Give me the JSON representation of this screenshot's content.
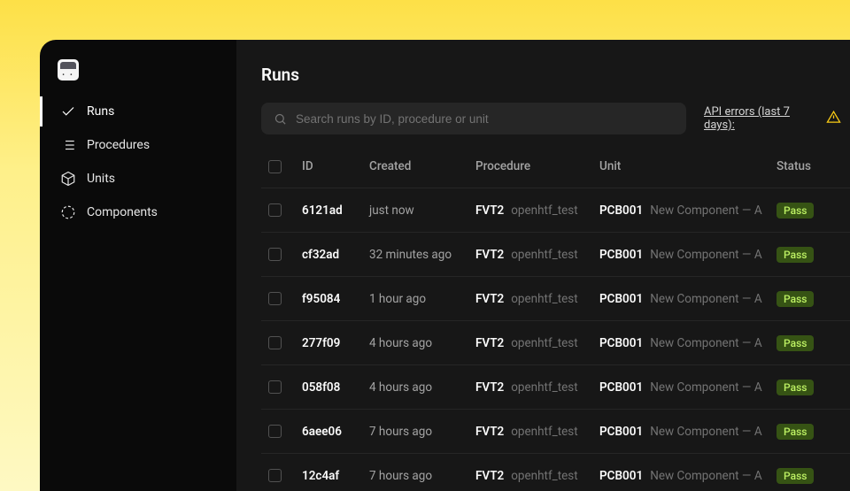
{
  "sidebar": {
    "items": [
      {
        "label": "Runs",
        "icon": "check",
        "active": true
      },
      {
        "label": "Procedures",
        "icon": "list",
        "active": false
      },
      {
        "label": "Units",
        "icon": "cube",
        "active": false
      },
      {
        "label": "Components",
        "icon": "circle-dashed",
        "active": false
      }
    ]
  },
  "page": {
    "title": "Runs"
  },
  "search": {
    "placeholder": "Search runs by ID, procedure or unit"
  },
  "api_errors": {
    "label": "API errors (last 7 days):"
  },
  "table": {
    "columns": {
      "id": "ID",
      "created": "Created",
      "procedure": "Procedure",
      "unit": "Unit",
      "status": "Status"
    },
    "rows": [
      {
        "id": "6121ad",
        "created": "just now",
        "proc_code": "FVT2",
        "proc_name": "openhtf_test",
        "unit_code": "PCB001",
        "unit_name": "New Component — A",
        "status": "Pass"
      },
      {
        "id": "cf32ad",
        "created": "32 minutes ago",
        "proc_code": "FVT2",
        "proc_name": "openhtf_test",
        "unit_code": "PCB001",
        "unit_name": "New Component — A",
        "status": "Pass"
      },
      {
        "id": "f95084",
        "created": "1 hour ago",
        "proc_code": "FVT2",
        "proc_name": "openhtf_test",
        "unit_code": "PCB001",
        "unit_name": "New Component — A",
        "status": "Pass"
      },
      {
        "id": "277f09",
        "created": "4 hours ago",
        "proc_code": "FVT2",
        "proc_name": "openhtf_test",
        "unit_code": "PCB001",
        "unit_name": "New Component — A",
        "status": "Pass"
      },
      {
        "id": "058f08",
        "created": "4 hours ago",
        "proc_code": "FVT2",
        "proc_name": "openhtf_test",
        "unit_code": "PCB001",
        "unit_name": "New Component — A",
        "status": "Pass"
      },
      {
        "id": "6aee06",
        "created": "7 hours ago",
        "proc_code": "FVT2",
        "proc_name": "openhtf_test",
        "unit_code": "PCB001",
        "unit_name": "New Component — A",
        "status": "Pass"
      },
      {
        "id": "12c4af",
        "created": "7 hours ago",
        "proc_code": "FVT2",
        "proc_name": "openhtf_test",
        "unit_code": "PCB001",
        "unit_name": "New Component — A",
        "status": "Pass"
      }
    ]
  },
  "colors": {
    "accent": "#fde047",
    "pass_bg": "#365314",
    "pass_fg": "#bef264"
  }
}
